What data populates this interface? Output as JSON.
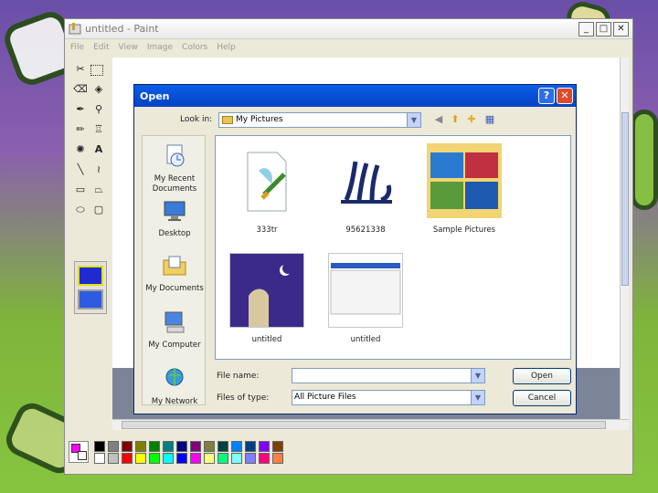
{
  "paint": {
    "title": "untitled - Paint",
    "menu": [
      "File",
      "Edit",
      "View",
      "Image",
      "Colors",
      "Help"
    ],
    "window_buttons": {
      "minimize": "_",
      "maximize": "□",
      "close": "✕"
    },
    "tools": [
      {
        "name": "free-form-select-icon",
        "glyph": "⬚"
      },
      {
        "name": "select-icon",
        "glyph": "⬚"
      },
      {
        "name": "eraser-icon",
        "glyph": "◇"
      },
      {
        "name": "fill-icon",
        "glyph": "⛶"
      },
      {
        "name": "pick-color-icon",
        "glyph": "✎"
      },
      {
        "name": "magnifier-icon",
        "glyph": "🔍"
      },
      {
        "name": "pencil-icon",
        "glyph": "✏"
      },
      {
        "name": "brush-icon",
        "glyph": "♜"
      },
      {
        "name": "airbrush-icon",
        "glyph": "✺"
      },
      {
        "name": "text-icon",
        "glyph": "A"
      },
      {
        "name": "line-icon",
        "glyph": "╲"
      },
      {
        "name": "curve-icon",
        "glyph": "∫"
      },
      {
        "name": "rectangle-icon",
        "glyph": "▭"
      },
      {
        "name": "polygon-icon",
        "glyph": "⏢"
      },
      {
        "name": "ellipse-icon",
        "glyph": "⬭"
      },
      {
        "name": "rounded-rectangle-icon",
        "glyph": "▢"
      }
    ],
    "current_colors": {
      "foreground": "#ff00ff",
      "background": "#ffffff"
    },
    "palette": [
      "#000000",
      "#808080",
      "#800000",
      "#808000",
      "#008000",
      "#008080",
      "#000080",
      "#800080",
      "#808040",
      "#004040",
      "#0080ff",
      "#004080",
      "#8000ff",
      "#804000",
      "#ffffff",
      "#c0c0c0",
      "#ff0000",
      "#ffff00",
      "#00ff00",
      "#00ffff",
      "#0000ff",
      "#ff00ff",
      "#ffff80",
      "#00ff80",
      "#80ffff",
      "#8080ff",
      "#ff0080",
      "#ff8040"
    ]
  },
  "dialog": {
    "title": "Open",
    "help_button": "?",
    "close_button": "✕",
    "look_in_label": "Look in:",
    "look_in_value": "My Pictures",
    "places": [
      {
        "label": "My Recent Documents",
        "icon": "recent-documents-icon"
      },
      {
        "label": "Desktop",
        "icon": "desktop-icon"
      },
      {
        "label": "My Documents",
        "icon": "my-documents-icon"
      },
      {
        "label": "My Computer",
        "icon": "my-computer-icon"
      },
      {
        "label": "My Network",
        "icon": "my-network-icon"
      }
    ],
    "files": [
      {
        "name": "333tr",
        "kind": "paint-brush-image"
      },
      {
        "name": "95621338",
        "kind": "calligraphy-image"
      },
      {
        "name": "Sample Pictures",
        "kind": "folder"
      },
      {
        "name": "untitled",
        "kind": "night-scene-image"
      },
      {
        "name": "untitled",
        "kind": "screenshot-image"
      }
    ],
    "file_name_label": "File name:",
    "file_name_value": "",
    "files_of_type_label": "Files of type:",
    "files_of_type_value": "All Picture Files",
    "open_button": "Open",
    "cancel_button": "Cancel"
  }
}
